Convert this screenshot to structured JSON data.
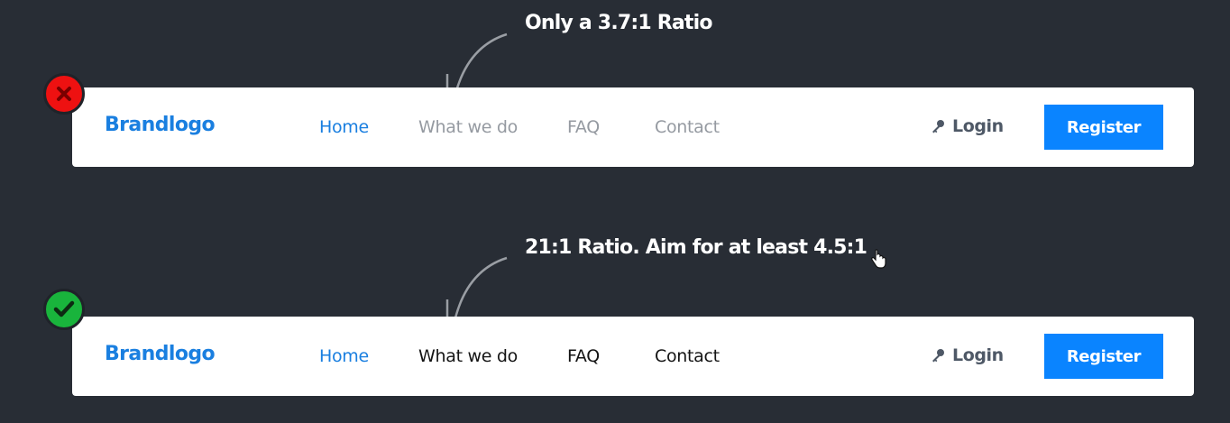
{
  "colors": {
    "background": "#282d35",
    "brand_blue": "#1a7fe0",
    "register_blue": "#0a84ff",
    "bad_badge": "#ee1111",
    "good_badge": "#19b43c",
    "low_contrast_link": "#959aa1",
    "high_contrast_link": "#141414",
    "login_color": "#4e5866"
  },
  "examples": [
    {
      "status": "fail",
      "status_icon": "close-icon",
      "annotation": "Only a 3.7:1 Ratio",
      "navbar": {
        "brand": "Brandlogo",
        "links": [
          "Home",
          "What we do",
          "FAQ",
          "Contact"
        ],
        "active_link": "Home",
        "login_icon": "key-icon",
        "login": "Login",
        "register": "Register"
      }
    },
    {
      "status": "pass",
      "status_icon": "check-icon",
      "annotation": "21:1 Ratio. Aim for at least 4.5:1",
      "navbar": {
        "brand": "Brandlogo",
        "links": [
          "Home",
          "What we do",
          "FAQ",
          "Contact"
        ],
        "active_link": "Home",
        "login_icon": "key-icon",
        "login": "Login",
        "register": "Register"
      }
    }
  ]
}
